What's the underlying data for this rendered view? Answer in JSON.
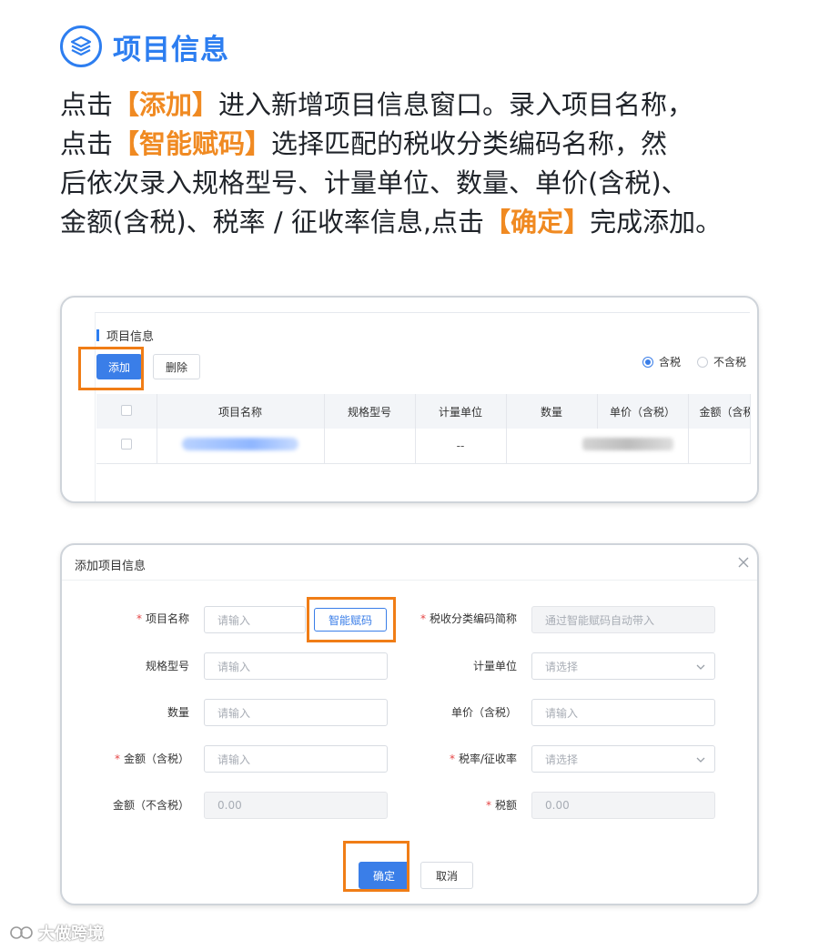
{
  "header": {
    "icon": "layers-icon",
    "title": "项目信息",
    "accent": "#2d7ef0"
  },
  "intro": {
    "l1_a": "点击",
    "l1_b": "【添加】",
    "l1_c": "进入新增项目信息窗口。录入项目名称，",
    "l2_a": "点击",
    "l2_b": "【智能赋码】",
    "l2_c": "选择匹配的税收分类编码名称，然",
    "l3": "后依次录入规格型号、计量单位、数量、单价(含税)、",
    "l4_a": "金额(含税)、税率 / 征收率信息,点击",
    "l4_b": "【确定】",
    "l4_c": "完成添加。",
    "highlight_color": "#f08a22"
  },
  "list_panel": {
    "title": "项目信息",
    "add_label": "添加",
    "delete_label": "删除",
    "radio_tax_incl": "含税",
    "radio_tax_excl": "不含税",
    "selected_radio": "含税",
    "columns": [
      "项目名称",
      "规格型号",
      "计量单位",
      "数量",
      "单价（含税）",
      "金额（含税"
    ],
    "rows": [
      {
        "unit": "--"
      }
    ]
  },
  "dialog": {
    "title": "添加项目信息",
    "fields": {
      "item_name_label": "项目名称",
      "item_name_placeholder": "请输入",
      "smart_code_label": "智能赋码",
      "tax_code_label": "税收分类编码简称",
      "tax_code_placeholder": "通过智能赋码自动带入",
      "spec_label": "规格型号",
      "spec_placeholder": "请输入",
      "unit_label": "计量单位",
      "unit_placeholder": "请选择",
      "qty_label": "数量",
      "qty_placeholder": "请输入",
      "price_label": "单价（含税）",
      "price_placeholder": "请输入",
      "amount_incl_label": "金额（含税）",
      "amount_incl_placeholder": "请输入",
      "rate_label": "税率/征收率",
      "rate_placeholder": "请选择",
      "amount_excl_label": "金额（不含税）",
      "amount_excl_value": "0.00",
      "tax_label": "税额",
      "tax_value": "0.00"
    },
    "confirm_label": "确定",
    "cancel_label": "取消"
  },
  "watermark": "大做跨境",
  "colors": {
    "primary": "#3a7ee8",
    "highlight_border": "#f07d16",
    "required": "#e54545"
  }
}
